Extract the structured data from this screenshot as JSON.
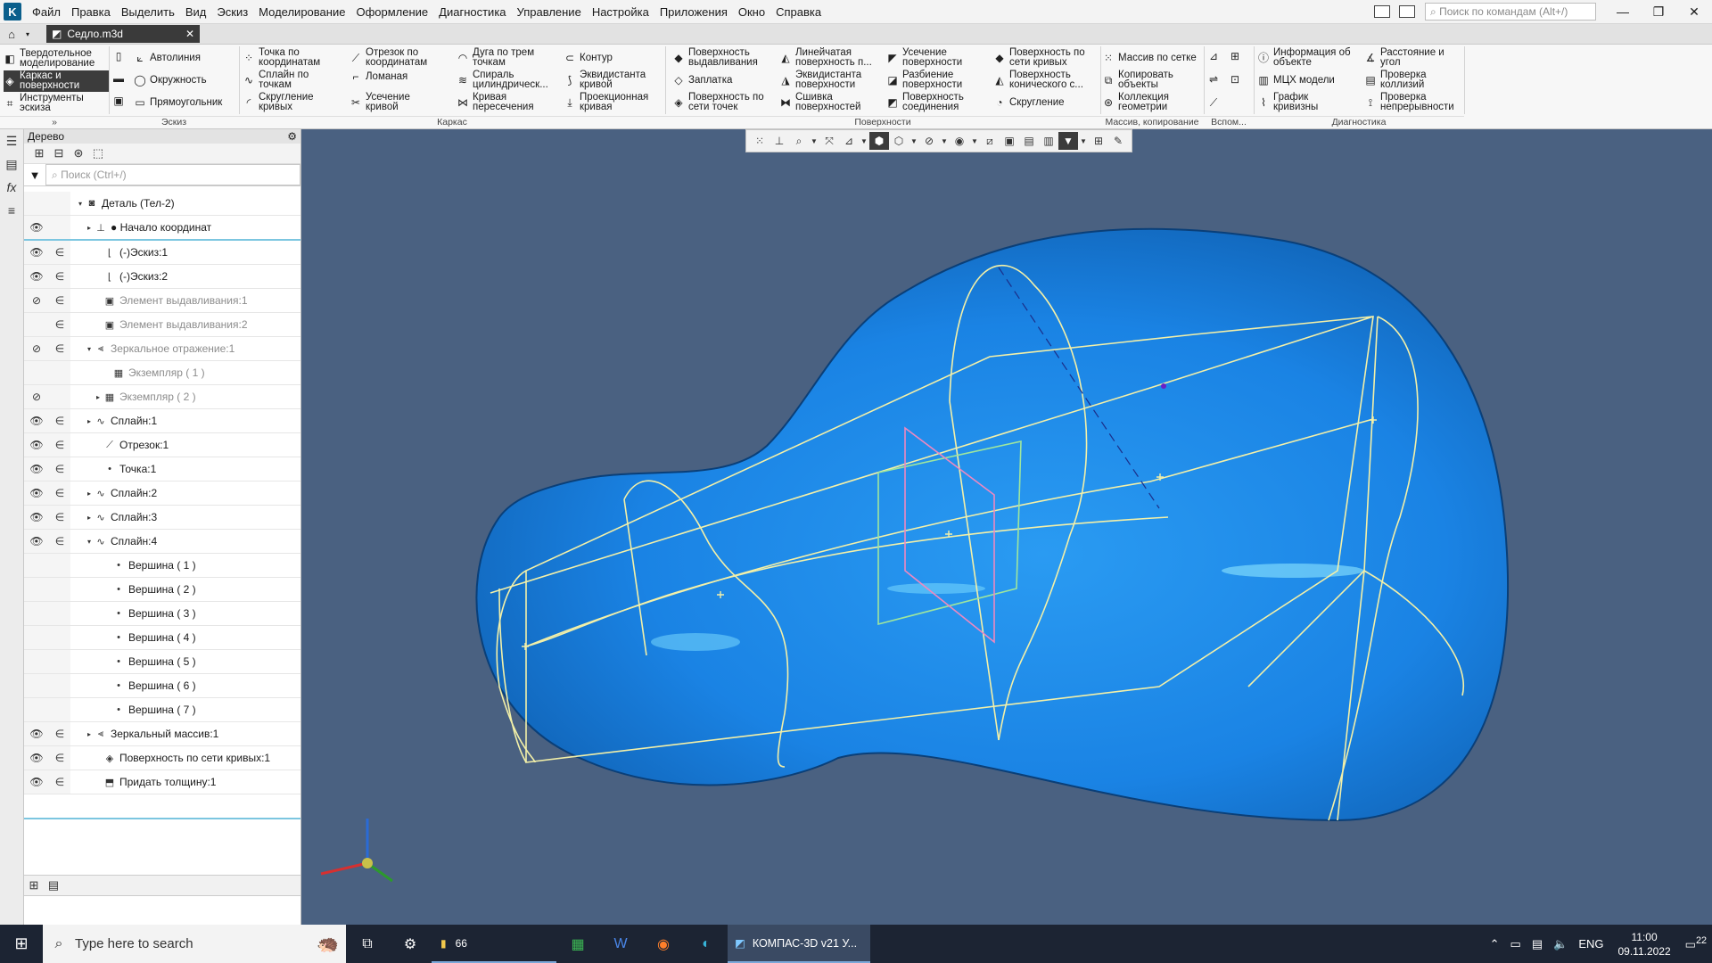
{
  "menubar": {
    "items": [
      "Файл",
      "Правка",
      "Выделить",
      "Вид",
      "Эскиз",
      "Моделирование",
      "Оформление",
      "Диагностика",
      "Управление",
      "Настройка",
      "Приложения",
      "Окно",
      "Справка"
    ],
    "search_placeholder": "Поиск по командам (Alt+/)",
    "minimize": "—",
    "restore": "❐",
    "close": "✕"
  },
  "tabbar": {
    "doc_title": "Седло.m3d",
    "close": "✕"
  },
  "ribbon": {
    "modes": [
      "Твердотельное\nмоделирование",
      "Каркас и\nповерхности",
      "Инструменты\nэскиза"
    ],
    "sketch": [
      "Автолиния",
      "Окружность",
      "Прямоугольник"
    ],
    "sketch_label": "Эскиз",
    "frame_col1": [
      "Точка по\nкоординатам",
      "Сплайн по\nточкам",
      "Скругление\nкривых"
    ],
    "frame_col2": [
      "Отрезок по\nкоординатам",
      "Ломаная",
      "Усечение\nкривой"
    ],
    "frame_col3": [
      "Дуга по трем\nточкам",
      "Спираль\nцилиндрическ...",
      "Кривая\nпересечения"
    ],
    "frame_col4": [
      "Контур",
      "Эквидистанта\nкривой",
      "Проекционная\nкривая"
    ],
    "frame_label": "Каркас",
    "surf_col1": [
      "Поверхность\nвыдавливания",
      "Заплатка",
      "Поверхность по\nсети точек"
    ],
    "surf_col2": [
      "Линейчатая\nповерхность п...",
      "Эквидистанта\nповерхности",
      "Сшивка\nповерхностей"
    ],
    "surf_col3": [
      "Усечение\nповерхности",
      "Разбиение\nповерхности",
      "Поверхность\nсоединения"
    ],
    "surf_col4": [
      "Поверхность по\nсети кривых",
      "Поверхность\nконического с...",
      "Скругление"
    ],
    "surf_label": "Поверхности",
    "array_items": [
      "Массив по сетке",
      "Копировать\nобъекты",
      "Коллекция\nгеометрии"
    ],
    "array_label": "Массив, копирование",
    "aux_label": "Вспом...",
    "diag_col1": [
      "Информация об\nобъекте",
      "МЦХ модели",
      "График\nкривизны"
    ],
    "diag_col2": [
      "Расстояние и\nугол",
      "Проверка\nколлизий",
      "Проверка\nнепрерывности"
    ],
    "diag_label": "Диагностика"
  },
  "tree": {
    "title": "Дерево",
    "search_placeholder": "Поиск (Ctrl+/)",
    "rows": [
      {
        "label": "Деталь (Тел-2)",
        "vis": "",
        "dep": "",
        "exp": "▾",
        "ico": "◙",
        "indent": 52,
        "grey": false
      },
      {
        "label": "● Начало координат",
        "vis": "👁",
        "dep": "",
        "exp": "▸",
        "ico": "⊥",
        "indent": 62,
        "grey": false
      },
      {
        "label": "(-)Эскиз:1",
        "vis": "👁",
        "dep": "∈",
        "exp": "",
        "ico": "⌊",
        "indent": 72,
        "grey": false
      },
      {
        "label": "(-)Эскиз:2",
        "vis": "👁",
        "dep": "∈",
        "exp": "",
        "ico": "⌊",
        "indent": 72,
        "grey": false
      },
      {
        "label": "Элемент выдавливания:1",
        "vis": "⊘",
        "dep": "∈",
        "exp": "",
        "ico": "▣",
        "indent": 72,
        "grey": true
      },
      {
        "label": "Элемент выдавливания:2",
        "vis": "",
        "dep": "∈",
        "exp": "",
        "ico": "▣",
        "indent": 72,
        "grey": true
      },
      {
        "label": "Зеркальное отражение:1",
        "vis": "⊘",
        "dep": "∈",
        "exp": "▾",
        "ico": "⫷",
        "indent": 62,
        "grey": true
      },
      {
        "label": "Экземпляр ( 1 )",
        "vis": "",
        "dep": "",
        "exp": "",
        "ico": "▦",
        "indent": 82,
        "grey": true
      },
      {
        "label": "Экземпляр ( 2 )",
        "vis": "⊘",
        "dep": "",
        "exp": "▸",
        "ico": "▦",
        "indent": 72,
        "grey": true
      },
      {
        "label": "Сплайн:1",
        "vis": "👁",
        "dep": "∈",
        "exp": "▸",
        "ico": "∿",
        "indent": 62,
        "grey": false
      },
      {
        "label": "Отрезок:1",
        "vis": "👁",
        "dep": "∈",
        "exp": "",
        "ico": "⟋",
        "indent": 72,
        "grey": false
      },
      {
        "label": "Точка:1",
        "vis": "👁",
        "dep": "∈",
        "exp": "",
        "ico": "•",
        "indent": 72,
        "grey": false
      },
      {
        "label": "Сплайн:2",
        "vis": "👁",
        "dep": "∈",
        "exp": "▸",
        "ico": "∿",
        "indent": 62,
        "grey": false
      },
      {
        "label": "Сплайн:3",
        "vis": "👁",
        "dep": "∈",
        "exp": "▸",
        "ico": "∿",
        "indent": 62,
        "grey": false
      },
      {
        "label": "Сплайн:4",
        "vis": "👁",
        "dep": "∈",
        "exp": "▾",
        "ico": "∿",
        "indent": 62,
        "grey": false
      },
      {
        "label": "Вершина ( 1 )",
        "vis": "",
        "dep": "",
        "exp": "",
        "ico": "•",
        "indent": 82,
        "grey": false
      },
      {
        "label": "Вершина ( 2 )",
        "vis": "",
        "dep": "",
        "exp": "",
        "ico": "•",
        "indent": 82,
        "grey": false
      },
      {
        "label": "Вершина ( 3 )",
        "vis": "",
        "dep": "",
        "exp": "",
        "ico": "•",
        "indent": 82,
        "grey": false
      },
      {
        "label": "Вершина ( 4 )",
        "vis": "",
        "dep": "",
        "exp": "",
        "ico": "•",
        "indent": 82,
        "grey": false
      },
      {
        "label": "Вершина ( 5 )",
        "vis": "",
        "dep": "",
        "exp": "",
        "ico": "•",
        "indent": 82,
        "grey": false
      },
      {
        "label": "Вершина ( 6 )",
        "vis": "",
        "dep": "",
        "exp": "",
        "ico": "•",
        "indent": 82,
        "grey": false
      },
      {
        "label": "Вершина ( 7 )",
        "vis": "",
        "dep": "",
        "exp": "",
        "ico": "•",
        "indent": 82,
        "grey": false
      },
      {
        "label": "Зеркальный массив:1",
        "vis": "👁",
        "dep": "∈",
        "exp": "▸",
        "ico": "⫷",
        "indent": 62,
        "grey": false
      },
      {
        "label": "Поверхность по сети кривых:1",
        "vis": "👁",
        "dep": "∈",
        "exp": "",
        "ico": "◈",
        "indent": 72,
        "grey": false
      },
      {
        "label": "Придать толщину:1",
        "vis": "👁",
        "dep": "∈",
        "exp": "",
        "ico": "⬒",
        "indent": 72,
        "grey": false
      }
    ]
  },
  "taskbar": {
    "search_placeholder": "Type here to search",
    "explorer_label": "66",
    "kompas_label": "КОМПАС-3D v21 У...",
    "lang": "ENG",
    "time": "11:00",
    "date": "09.11.2022",
    "notifications": "22"
  },
  "colors": {
    "viewport_bg": "#4a6181",
    "surface": "#1f86e6",
    "curves": "#f3f0a8",
    "taskbar": "#1c2433"
  }
}
